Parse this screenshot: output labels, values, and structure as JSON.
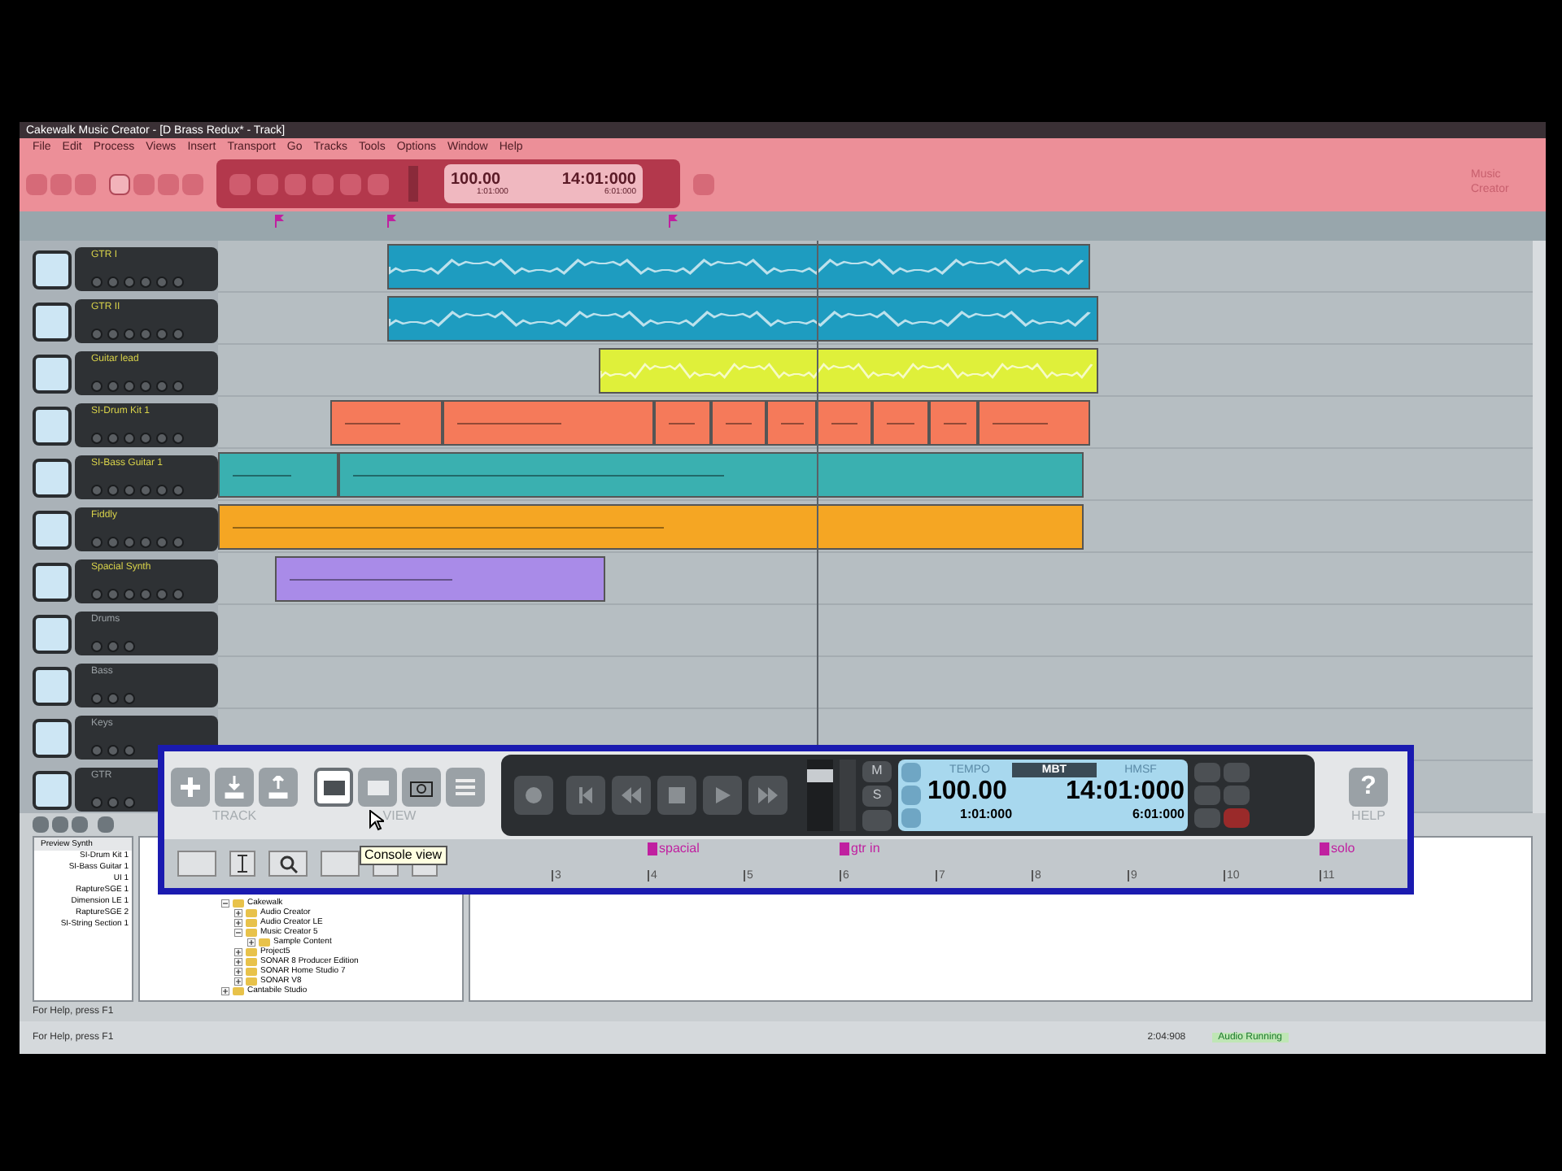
{
  "window": {
    "title": "Cakewalk Music Creator - [D Brass Redux* - Track]"
  },
  "menu": [
    "File",
    "Edit",
    "Process",
    "Views",
    "Insert",
    "Transport",
    "Go",
    "Tracks",
    "Tools",
    "Options",
    "Window",
    "Help"
  ],
  "control_bar": {
    "tempo": "100.00",
    "time": "14:01:000",
    "start": "1:01:000",
    "end": "6:01:000",
    "brand": "Music Creator"
  },
  "tracks": [
    {
      "name": "GTR I",
      "kind": "active",
      "clips": [
        {
          "kind": "audio",
          "color": "#1e9cc0"
        }
      ]
    },
    {
      "name": "GTR II",
      "kind": "active",
      "clips": [
        {
          "kind": "audio",
          "color": "#1e9cc0"
        }
      ]
    },
    {
      "name": "Guitar lead",
      "kind": "active",
      "clips": [
        {
          "kind": "audio",
          "color": "#dff03a"
        }
      ]
    },
    {
      "name": "SI-Drum Kit 1",
      "kind": "active",
      "clips": [
        {
          "kind": "midi",
          "color": "#f57a5a"
        },
        {
          "kind": "midi",
          "color": "#f57a5a"
        },
        {
          "kind": "midi",
          "color": "#f57a5a"
        },
        {
          "kind": "midi",
          "color": "#f57a5a"
        },
        {
          "kind": "midi",
          "color": "#f57a5a"
        },
        {
          "kind": "midi",
          "color": "#f57a5a"
        },
        {
          "kind": "midi",
          "color": "#f57a5a"
        },
        {
          "kind": "midi",
          "color": "#f57a5a"
        },
        {
          "kind": "midi",
          "color": "#f57a5a"
        }
      ]
    },
    {
      "name": "SI-Bass Guitar 1",
      "kind": "active",
      "clips": [
        {
          "kind": "midi",
          "color": "#3ab0b0"
        },
        {
          "kind": "midi",
          "color": "#3ab0b0"
        }
      ]
    },
    {
      "name": "Fiddly",
      "kind": "active",
      "clips": [
        {
          "kind": "midi",
          "color": "#f5a623"
        }
      ]
    },
    {
      "name": "Spacial Synth",
      "kind": "active",
      "clips": [
        {
          "kind": "midi",
          "color": "#a98be8"
        }
      ]
    },
    {
      "name": "Drums",
      "kind": "empty"
    },
    {
      "name": "Bass",
      "kind": "empty"
    },
    {
      "name": "Keys",
      "kind": "empty"
    },
    {
      "name": "GTR",
      "kind": "empty"
    }
  ],
  "zoom_panel": {
    "track_label": "TRACK",
    "view_label": "VIEW",
    "help_label": "HELP",
    "help_key": "?",
    "display": {
      "tempo_label": "TEMPO",
      "mbt_label": "MBT",
      "hmsf_label": "HMSF",
      "tempo": "100.00",
      "time": "14:01:000",
      "start": "1:01:000",
      "end": "6:01:000"
    },
    "mixer_keys": [
      "M",
      "S"
    ],
    "tooltip": "Console view",
    "ruler_ticks": [
      "3",
      "4",
      "5",
      "6",
      "7",
      "8",
      "9",
      "10",
      "11"
    ],
    "markers": [
      {
        "label": "spacial"
      },
      {
        "label": "gtr in"
      },
      {
        "label": "solo"
      }
    ]
  },
  "browser": {
    "list_header": "Preview Synth",
    "list": [
      "SI-Drum Kit 1",
      "SI-Bass Guitar 1",
      "UI 1",
      "RaptureSGE 1",
      "Dimension LE 1",
      "RaptureSGE 2",
      "SI-String Section 1"
    ],
    "tree": [
      {
        "label": "Cakewalk",
        "expanded": true,
        "children": [
          {
            "label": "Audio Creator",
            "expanded": false
          },
          {
            "label": "Audio Creator LE",
            "expanded": false
          },
          {
            "label": "Music Creator 5",
            "expanded": true,
            "children": [
              {
                "label": "Sample Content",
                "expanded": false
              }
            ]
          },
          {
            "label": "Project5",
            "expanded": false
          },
          {
            "label": "SONAR 8 Producer Edition",
            "expanded": false
          },
          {
            "label": "SONAR Home Studio 7",
            "expanded": false
          },
          {
            "label": "SONAR V8",
            "expanded": false
          }
        ]
      },
      {
        "label": "Cantabile Studio",
        "expanded": false
      }
    ],
    "hint": "For Help, press F1"
  },
  "status_bar": {
    "hint": "For Help, press F1",
    "position": "2:04:908",
    "engine": "Audio Running"
  }
}
